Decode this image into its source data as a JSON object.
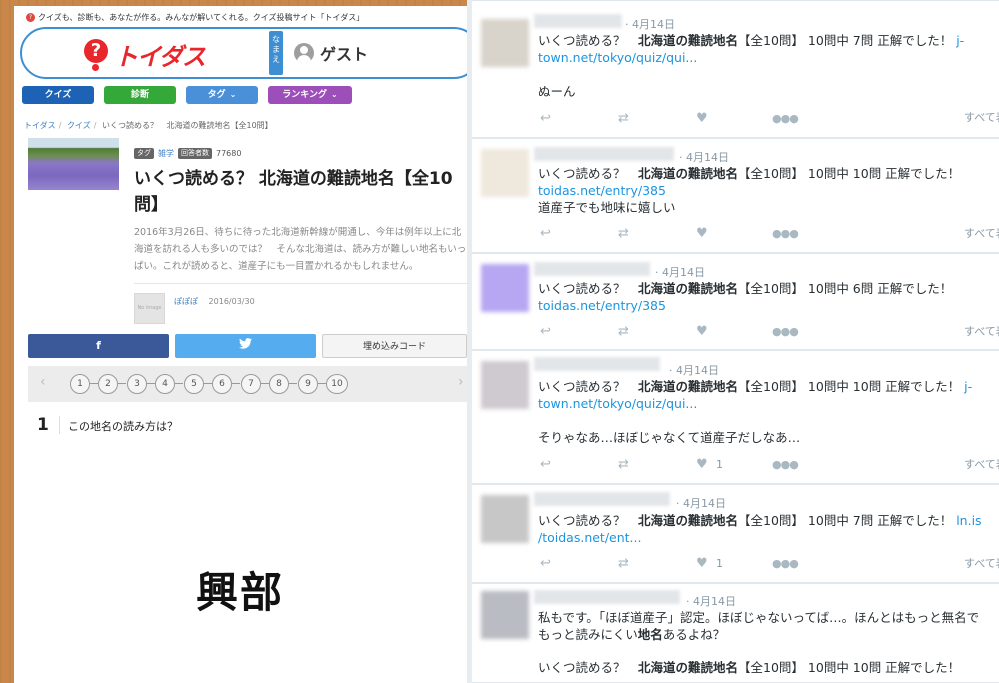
{
  "left": {
    "tagline": "クイズも、診断も、あなたが作る。みんなが解いてくれる。クイズ投稿サイト「トイダス」",
    "logo_text": "トイダス",
    "namae_label": "なまえ",
    "guest_label": "ゲスト",
    "nav": [
      {
        "label": "クイズ",
        "color": "#1d62b4"
      },
      {
        "label": "診断",
        "color": "#35a83a"
      },
      {
        "label": "タグ",
        "color": "#4a90d9"
      },
      {
        "label": "ランキング",
        "color": "#9c4fb8"
      }
    ],
    "breadcrumb": [
      "トイダス",
      "クイズ",
      "いくつ読める？",
      "北海道の難読地名【全10問】"
    ],
    "tags": {
      "chip1": "タグ",
      "link": "雑学",
      "chip2": "回答者数",
      "count": "77680"
    },
    "title": "いくつ読める？ 北海道の難読地名【全10問】",
    "description": "2016年3月26日、待ちに待った北海道新幹線が開通し、今年は例年以上に北海道を訪れる人も多いのでは？　そんな北海道は、読み方が難しい地名もいっぱい。これが読めると、道産子にも一目置かれるかもしれません。",
    "author_image_label": "No image",
    "author": "ぽぽぽ",
    "date": "2016/03/30",
    "share": {
      "facebook": "f",
      "twitter": "t",
      "embed": "埋め込みコード"
    },
    "pages": [
      "1",
      "2",
      "3",
      "4",
      "5",
      "6",
      "7",
      "8",
      "9",
      "10"
    ],
    "question_number": "1",
    "question_text": "この地名の読み方は？",
    "answer_place": "興部"
  },
  "tweets": [
    {
      "date": "· 4月14日",
      "line1_pre": "いくつ読める？　",
      "line1_bold": "北海道の難読地名",
      "line1_post": "【全10問】 10問中 7問 正解でした！",
      "link1": "j-",
      "link2": "town.net/tokyo/quiz/qui...",
      "comment": "ぬーん",
      "likes": "",
      "seeall": "すべて表示"
    },
    {
      "date": "· 4月14日",
      "line1_pre": "いくつ読める？　",
      "line1_bold": "北海道の難読地名",
      "line1_post": "【全10問】 10問中 10問 正解でした！",
      "link1": "",
      "link2": "toidas.net/entry/385",
      "comment": "道産子でも地味に嬉しい",
      "likes": "",
      "seeall": "すべて表示"
    },
    {
      "date": "· 4月14日",
      "line1_pre": "いくつ読める？　",
      "line1_bold": "北海道の難読地名",
      "line1_post": "【全10問】 10問中 6問 正解でした！",
      "link1": "",
      "link2": "toidas.net/entry/385",
      "comment": "",
      "likes": "",
      "seeall": "すべて表示"
    },
    {
      "date": "· 4月14日",
      "line1_pre": "いくつ読める？　",
      "line1_bold": "北海道の難読地名",
      "line1_post": "【全10問】 10問中 10問 正解でした！",
      "link1": "j-",
      "link2": "town.net/tokyo/quiz/qui...",
      "comment": "そりゃなあ…ほぼじゃなくて道産子だしなあ…",
      "likes": "1",
      "seeall": "すべて表示"
    },
    {
      "date": "· 4月14日",
      "line1_pre": "いくつ読める？　",
      "line1_bold": "北海道の難読地名",
      "line1_post": "【全10問】 10問中 7問 正解でした！",
      "link1": "ln.is",
      "link2": "/toidas.net/ent...",
      "comment": "",
      "likes": "1",
      "seeall": "すべて表示"
    },
    {
      "date": "· 4月14日",
      "text1": "私もです。「ほぼ道産子」認定。ほぼじゃないってば…。ほんとはもっと無名で",
      "text2_pre": "もっと読みにくい",
      "text2_bold": "地名",
      "text2_post": "あるよね？",
      "line1_pre": "いくつ読める？　",
      "line1_bold": "北海道の難読地名",
      "line1_post": "【全10問】 10問中 10問 正解でした！"
    }
  ]
}
